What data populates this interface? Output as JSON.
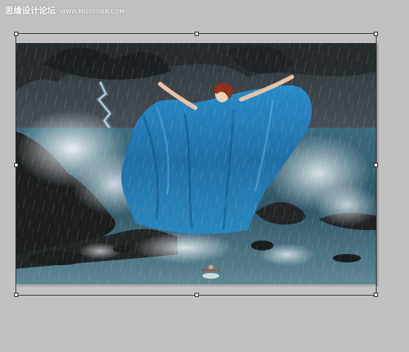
{
  "watermark": {
    "cn_text": "思缘设计论坛",
    "url_text": "WWW.MISSYUAN.COM"
  },
  "canvas": {
    "background_color": "#c1c1c1",
    "transform_mode": "free-transform"
  },
  "image": {
    "subject": "woman-in-blue-gown-on-stormy-sea-rocks"
  },
  "colors": {
    "gown": "#1f78b4",
    "sea": "#2f5566",
    "sky": "#3c454c",
    "rocks": "#1c1e1f"
  }
}
